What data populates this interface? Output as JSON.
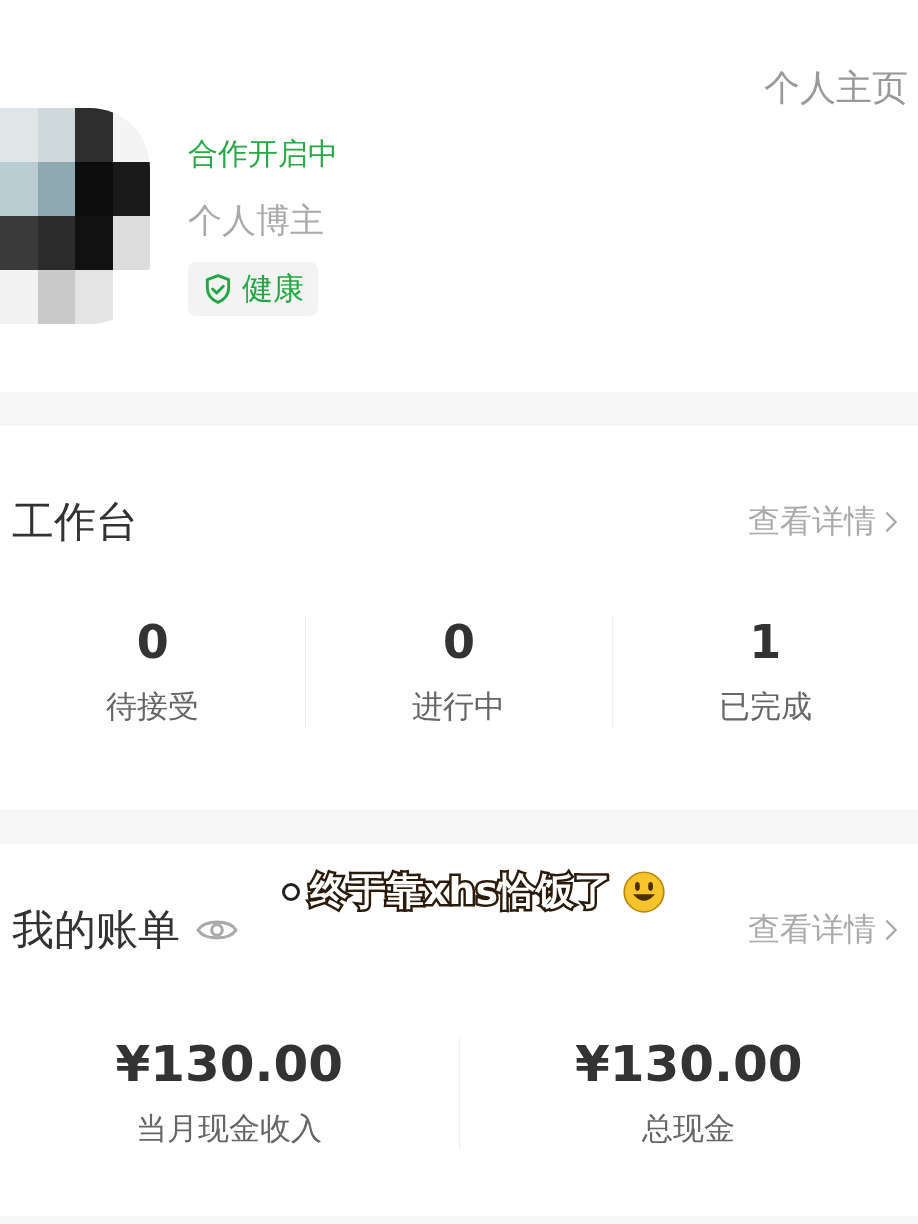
{
  "profile": {
    "homepage_link": "个人主页",
    "status": "合作开启中",
    "role": "个人博主",
    "health_badge": "健康"
  },
  "workbench": {
    "title": "工作台",
    "details_link": "查看详情",
    "stats": [
      {
        "value": "0",
        "label": "待接受"
      },
      {
        "value": "0",
        "label": "进行中"
      },
      {
        "value": "1",
        "label": "已完成"
      }
    ]
  },
  "bill": {
    "title": "我的账单",
    "details_link": "查看详情",
    "amounts": [
      {
        "value": "¥130.00",
        "label": "当月现金收入"
      },
      {
        "value": "¥130.00",
        "label": "总现金"
      }
    ]
  },
  "caption": {
    "text": "终于靠xhs恰饭了"
  }
}
